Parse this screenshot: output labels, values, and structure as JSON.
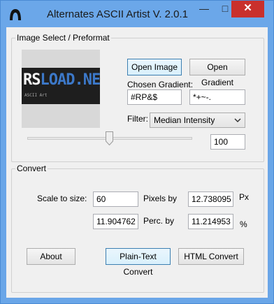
{
  "window": {
    "title": "Alternates ASCII Artist V. 2.0.1",
    "minimize_glyph": "—",
    "maximize_glyph": "□",
    "close_glyph": "✕"
  },
  "image_group": {
    "legend": "Image Select / Preformat",
    "preview_logo_left": "RS",
    "preview_logo_right": "LOAD.NET",
    "preview_caption": "ASCII Art",
    "open_image_label": "Open Image",
    "open_gradient_label": "Open Gradient",
    "chosen_gradient_label": "Chosen Gradient:",
    "gradient_primary_value": "#RP&$",
    "gradient_secondary_value": "*+~-.",
    "filter_label": "Filter:",
    "filter_selected": "Median Intensity",
    "slider_fraction": 0.5,
    "slider_value": "100"
  },
  "convert_group": {
    "legend": "Convert",
    "scale_label": "Scale to size:",
    "scale_value": "60",
    "pixels_by_label": "Pixels by",
    "pixels_by_value": "12.738095",
    "px_unit": "Px",
    "second_value": "11.904762",
    "perc_by_label": "Perc. by",
    "perc_by_value": "11.214953",
    "percent_unit": "%",
    "about_label": "About",
    "plain_text_label": "Plain-Text Convert",
    "html_label": "HTML Convert"
  },
  "colors": {
    "title_bar": "#6ba7e9",
    "close_button": "#c9302c",
    "client_bg": "#f0f0f0"
  }
}
